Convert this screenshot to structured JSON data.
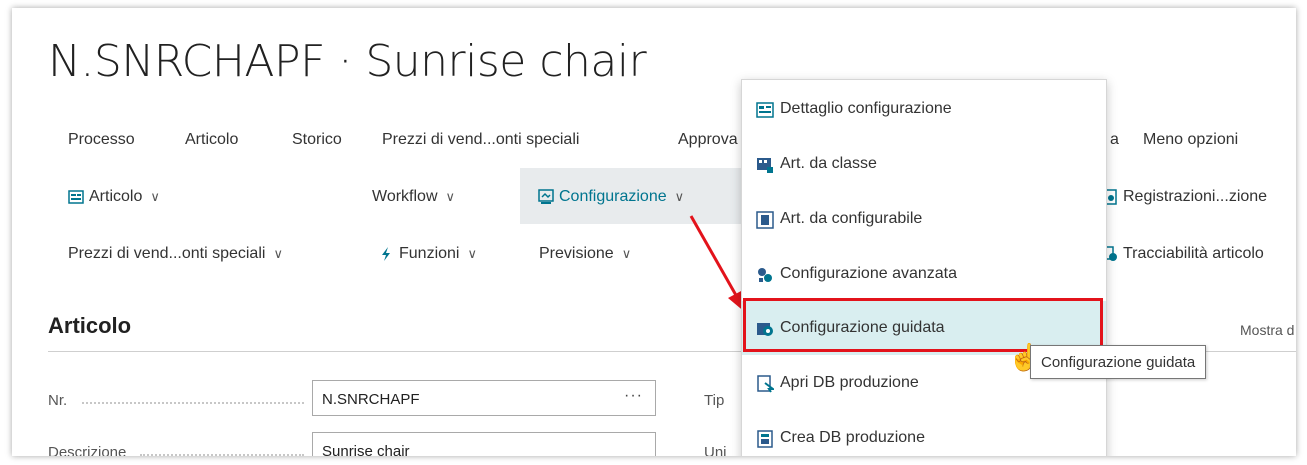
{
  "page": {
    "title": "N.SNRCHAPF · Sunrise chair"
  },
  "tabs": [
    {
      "label": "Processo"
    },
    {
      "label": "Articolo"
    },
    {
      "label": "Storico"
    },
    {
      "label": "Prezzi di vend...onti speciali"
    },
    {
      "label": "Approva"
    },
    {
      "label": "a"
    },
    {
      "label": "Meno opzioni"
    }
  ],
  "actions": {
    "articolo": "Articolo",
    "workflow": "Workflow",
    "configurazione": "Configurazione",
    "registrazioni": "Registrazioni...zione",
    "prezzi": "Prezzi di vend...onti speciali",
    "funzioni": "Funzioni",
    "previsione": "Previsione",
    "tracciabilita": "Tracciabilità articolo"
  },
  "section": {
    "title": "Articolo",
    "show_more": "Mostra d"
  },
  "fields": {
    "nr": {
      "label": "Nr.",
      "value": "N.SNRCHAPF",
      "ellipsis": "···"
    },
    "descrizione": {
      "label": "Descrizione",
      "value": "Sunrise chair"
    },
    "tipo": {
      "label": "Tip"
    },
    "unita": {
      "label": "Uni"
    }
  },
  "menu": {
    "items": [
      {
        "label": "Dettaglio configurazione",
        "icon": "configuration-detail-icon"
      },
      {
        "label": "Art. da classe",
        "icon": "item-class-icon"
      },
      {
        "label": "Art. da configurabile",
        "icon": "configurable-item-icon"
      },
      {
        "label": "Configurazione avanzata",
        "icon": "advanced-configuration-icon"
      },
      {
        "label": "Configurazione guidata",
        "icon": "guided-configuration-icon"
      },
      {
        "label": "Apri DB produzione",
        "icon": "open-bom-icon"
      },
      {
        "label": "Crea DB produzione",
        "icon": "create-bom-icon"
      }
    ]
  },
  "tooltip": {
    "text": "Configurazione guidata"
  },
  "colors": {
    "accent": "#00758f",
    "annotation": "#e3131b",
    "selected": "#d9eef0"
  }
}
